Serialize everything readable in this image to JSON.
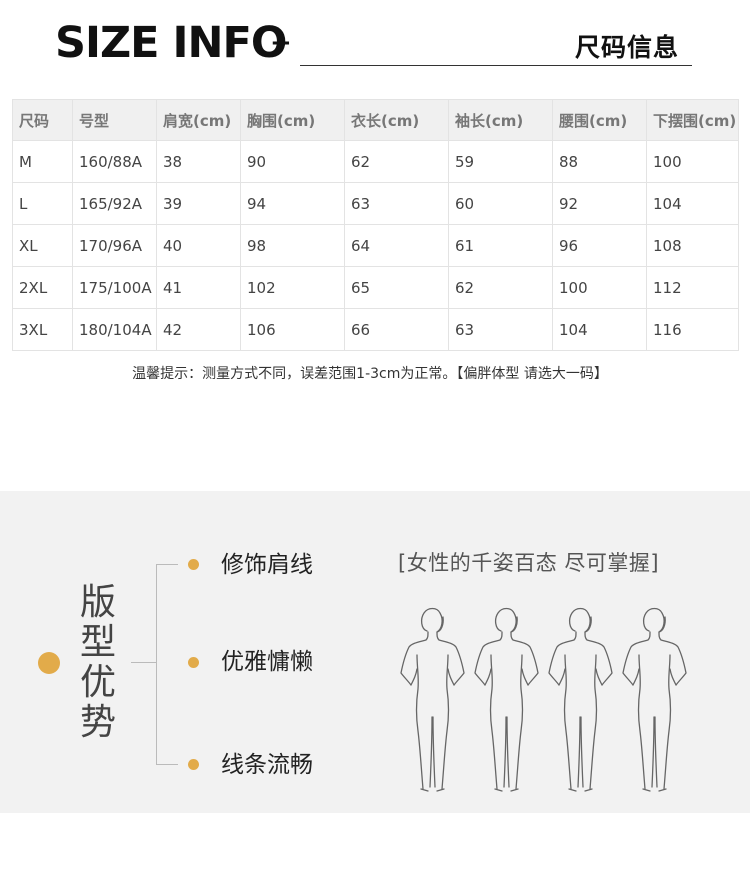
{
  "header": {
    "title": "SIZE INFO",
    "plus": "+",
    "subtitle": "尺码信息"
  },
  "table": {
    "columns": [
      "尺码",
      "号型",
      "肩宽(cm)",
      "胸围(cm)",
      "衣长(cm)",
      "袖长(cm)",
      "腰围(cm)",
      "下摆围(cm)"
    ],
    "rows": [
      [
        "M",
        "160/88A",
        "38",
        "90",
        "62",
        "59",
        "88",
        "100"
      ],
      [
        "L",
        "165/92A",
        "39",
        "94",
        "63",
        "60",
        "92",
        "104"
      ],
      [
        "XL",
        "170/96A",
        "40",
        "98",
        "64",
        "61",
        "96",
        "108"
      ],
      [
        "2XL",
        "175/100A",
        "41",
        "102",
        "65",
        "62",
        "100",
        "112"
      ],
      [
        "3XL",
        "180/104A",
        "42",
        "106",
        "66",
        "63",
        "104",
        "116"
      ]
    ]
  },
  "note": "温馨提示：测量方式不同，误差范围1-3cm为正常。【偏胖体型 请选大一码】",
  "advantages": {
    "title": "版型优势",
    "items": [
      "修饰肩线",
      "优雅慵懒",
      "线条流畅"
    ],
    "slogan": "[女性的千姿百态 尽可掌握]",
    "accent_color": "#e2ab4a",
    "figure_icon": "female-body-silhouette-icon"
  }
}
